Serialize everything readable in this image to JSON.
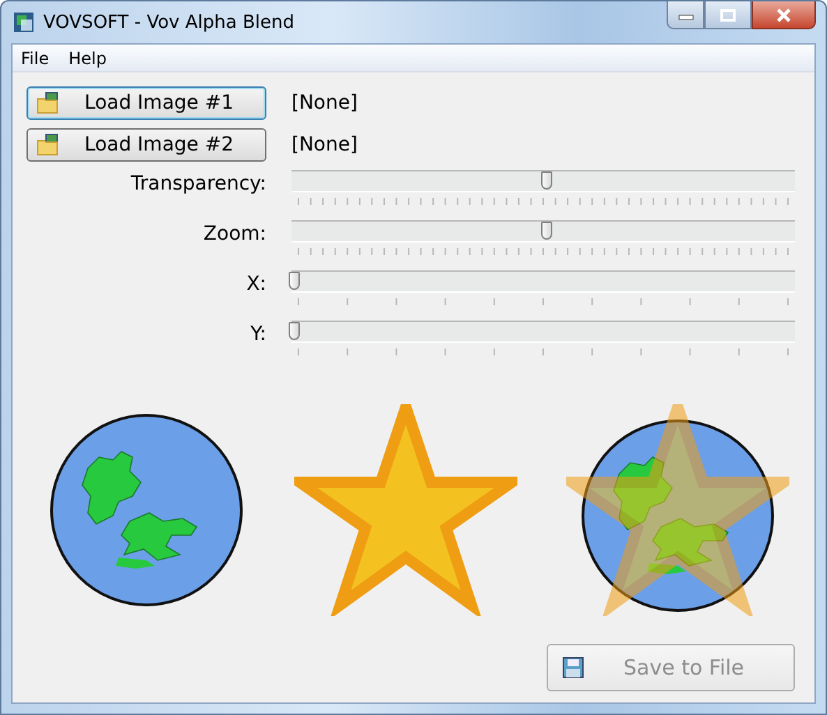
{
  "window": {
    "title": "VOVSOFT - Vov Alpha Blend"
  },
  "menu": [
    "File",
    "Help"
  ],
  "loads": [
    {
      "label": "Load Image #1",
      "focused": true,
      "file": "[None]"
    },
    {
      "label": "Load Image #2",
      "focused": false,
      "file": "[None]"
    }
  ],
  "sliders": [
    {
      "label": "Transparency:",
      "kind": "fine",
      "level": 0.5
    },
    {
      "label": "Zoom:",
      "kind": "fine",
      "level": 0.5
    },
    {
      "label": "X:",
      "kind": "coarse",
      "level": 0
    },
    {
      "label": "Y:",
      "kind": "coarse",
      "level": 0
    }
  ],
  "previews": [
    {
      "kind": "globe"
    },
    {
      "kind": "star"
    },
    {
      "kind": "blend"
    }
  ],
  "save_button": {
    "label": "Save to File",
    "disabled": true
  }
}
